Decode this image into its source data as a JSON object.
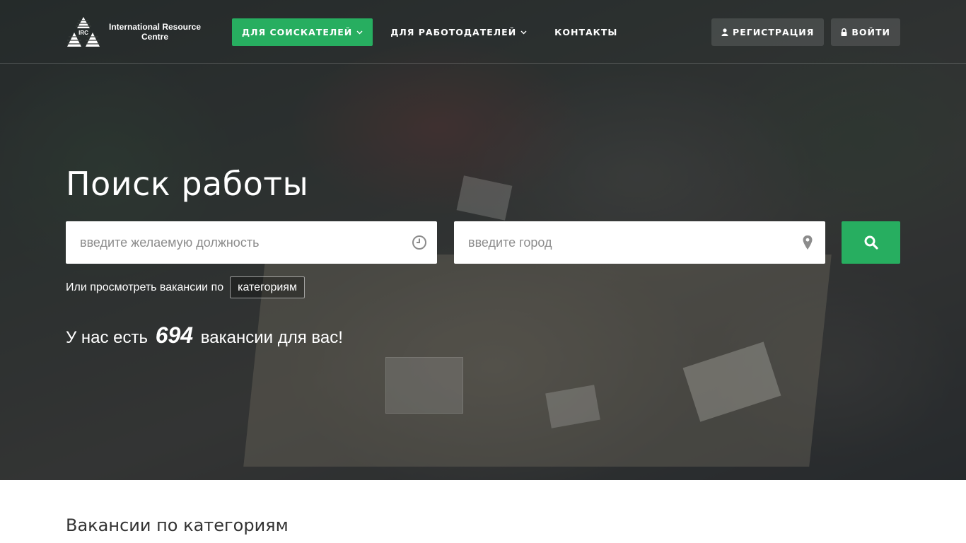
{
  "brand": {
    "logo_mark_text": "IRC",
    "logo_name_line1": "International Resource",
    "logo_name_line2": "Centre"
  },
  "nav": {
    "items": [
      {
        "label": "ДЛЯ СОИСКАТЕЛЕЙ",
        "icon": "chevron-down-icon",
        "active": true
      },
      {
        "label": "ДЛЯ РАБОТОДАТЕЛЕЙ",
        "icon": "chevron-down-icon",
        "active": false
      },
      {
        "label": "КОНТАКТЫ",
        "active": false
      }
    ],
    "accent_color": "#27ae60"
  },
  "auth": {
    "register_label": "РЕГИСТРАЦИЯ",
    "register_icon": "user-icon",
    "login_label": "ВОЙТИ",
    "login_icon": "lock-icon"
  },
  "hero": {
    "title": "Поиск работы",
    "position_placeholder": "введите желаемую должность",
    "position_icon": "clock-icon",
    "city_placeholder": "введите город",
    "city_icon": "map-pin-icon",
    "search_icon": "search-icon",
    "browse_text": "Или просмотреть вакансии по",
    "browse_button": "категориям",
    "count_prefix": "У нас есть",
    "count_value": "694",
    "count_suffix": "вакансии для вас!"
  },
  "sections": {
    "categories_title": "Вакансии по категориям"
  }
}
